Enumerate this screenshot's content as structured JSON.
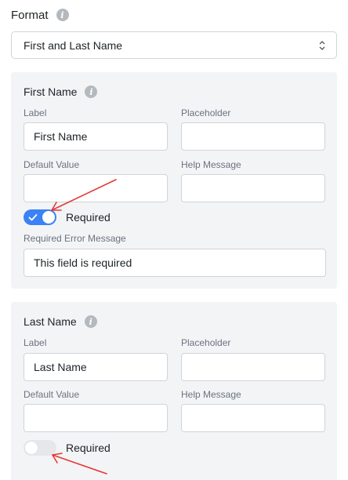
{
  "format": {
    "label": "Format",
    "selected": "First and Last Name"
  },
  "first_name": {
    "title": "First Name",
    "label_caption": "Label",
    "label_value": "First Name",
    "placeholder_caption": "Placeholder",
    "placeholder_value": "",
    "default_caption": "Default Value",
    "default_value": "",
    "help_caption": "Help Message",
    "help_value": "",
    "required_label": "Required",
    "required_on": true,
    "error_caption": "Required Error Message",
    "error_value": "This field is required"
  },
  "last_name": {
    "title": "Last Name",
    "label_caption": "Label",
    "label_value": "Last Name",
    "placeholder_caption": "Placeholder",
    "placeholder_value": "",
    "default_caption": "Default Value",
    "default_value": "",
    "help_caption": "Help Message",
    "help_value": "",
    "required_label": "Required",
    "required_on": false
  },
  "colors": {
    "toggle_on": "#3b82f6",
    "annotation_arrow": "#e53935"
  }
}
